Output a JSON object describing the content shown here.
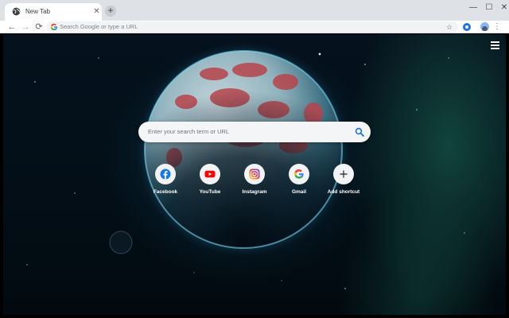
{
  "tab": {
    "title": "New Tab",
    "close_glyph": "✕",
    "new_tab_glyph": "+"
  },
  "window_controls": {
    "minimize": "—",
    "maximize": "☐",
    "close": "✕"
  },
  "toolbar": {
    "back_glyph": "←",
    "forward_glyph": "→",
    "reload_glyph": "⟳",
    "omnibox_placeholder": "Search Google or type a URL",
    "bookmark_glyph": "☆",
    "menu_glyph": "⋮"
  },
  "search": {
    "placeholder": "Enter your search term or URL",
    "icon": "search-icon",
    "icon_color": "#1a73e8"
  },
  "shortcuts": [
    {
      "label": "Facebook",
      "icon": "facebook-icon",
      "color": "#1877f2"
    },
    {
      "label": "YouTube",
      "icon": "youtube-icon",
      "color": "#ff0000"
    },
    {
      "label": "Instagram",
      "icon": "instagram-icon",
      "color": "#c13584"
    },
    {
      "label": "Gmail",
      "icon": "google-icon",
      "color": "#4285f4"
    },
    {
      "label": "Add shortcut",
      "icon": "plus-icon",
      "color": "#3c4043"
    }
  ],
  "colors": {
    "tab_strip": "#dee1e6",
    "toolbar": "#ffffff",
    "omnibox": "#f1f3f4",
    "accent": "#1a73e8"
  }
}
